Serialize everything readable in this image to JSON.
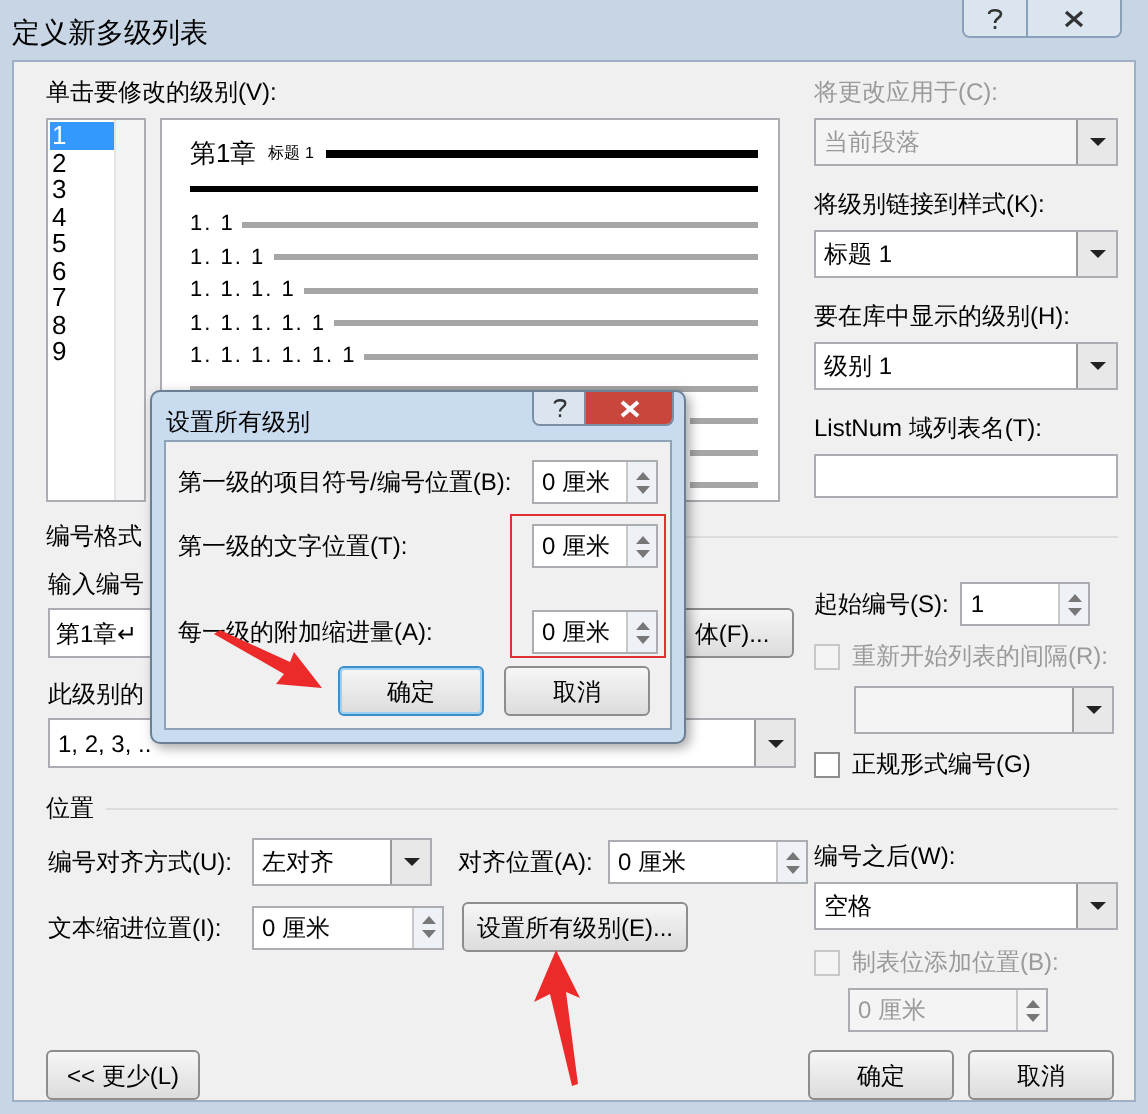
{
  "window": {
    "title": "定义新多级列表"
  },
  "level_picker": {
    "label": "单击要修改的级别(V):",
    "items": [
      {
        "label": "1",
        "selected": true
      },
      {
        "label": "2",
        "selected": false
      },
      {
        "label": "3",
        "selected": false
      },
      {
        "label": "4",
        "selected": false
      },
      {
        "label": "5",
        "selected": false
      },
      {
        "label": "6",
        "selected": false
      },
      {
        "label": "7",
        "selected": false
      },
      {
        "label": "8",
        "selected": false
      },
      {
        "label": "9",
        "selected": false
      }
    ]
  },
  "preview": {
    "heading_number": "第1章",
    "heading_style": "标题 1",
    "rows": [
      "1. 1",
      "1. 1. 1",
      "1. 1. 1. 1",
      "1. 1. 1. 1. 1",
      "1. 1. 1. 1. 1. 1"
    ]
  },
  "right_panel": [
    {
      "label": "将更改应用于(C):",
      "value": "当前段落",
      "disabled": true,
      "kind": "dropdown"
    },
    {
      "label": "将级别链接到样式(K):",
      "value": "标题 1",
      "disabled": false,
      "kind": "dropdown"
    },
    {
      "label": "要在库中显示的级别(H):",
      "value": "级别 1",
      "disabled": false,
      "kind": "dropdown"
    },
    {
      "label": "ListNum 域列表名(T):",
      "disabled": false,
      "kind": "input"
    }
  ],
  "number_format": {
    "title": "编号格式",
    "format_label": "输入编号",
    "format_value": "第1章↵",
    "font_button": "体(F)...",
    "style_label": "此级别的",
    "style_value": "1, 2, 3, ..",
    "start_label": "起始编号(S):",
    "start_value": "1",
    "restart": {
      "label": "重新开始列表的间隔(R):",
      "checked": false,
      "disabled": true
    },
    "legal": {
      "label": "正规形式编号(G)",
      "checked": false,
      "disabled": false
    }
  },
  "position": {
    "title": "位置",
    "align_label": "编号对齐方式(U):",
    "align_value": "左对齐",
    "at_label": "对齐位置(A):",
    "at_value": "0 厘米",
    "indent_label": "文本缩进位置(I):",
    "indent_value": "0 厘米",
    "set_all_button": "设置所有级别(E)...",
    "follow_label": "编号之后(W):",
    "follow_value": "空格",
    "tab_stop": {
      "label": "制表位添加位置(B):",
      "checked": false,
      "disabled": true
    },
    "tab_value": "0 厘米"
  },
  "buttons": {
    "less": "<< 更少(L)",
    "ok": "确定",
    "cancel": "取消"
  },
  "sub_dialog": {
    "title": "设置所有级别",
    "rows": [
      {
        "label": "第一级的项目符号/编号位置(B):",
        "value": "0 厘米"
      },
      {
        "label": "第一级的文字位置(T):",
        "value": "0 厘米"
      },
      {
        "label": "每一级的附加缩进量(A):",
        "value": "0 厘米"
      }
    ],
    "ok": "确定",
    "cancel": "取消"
  }
}
